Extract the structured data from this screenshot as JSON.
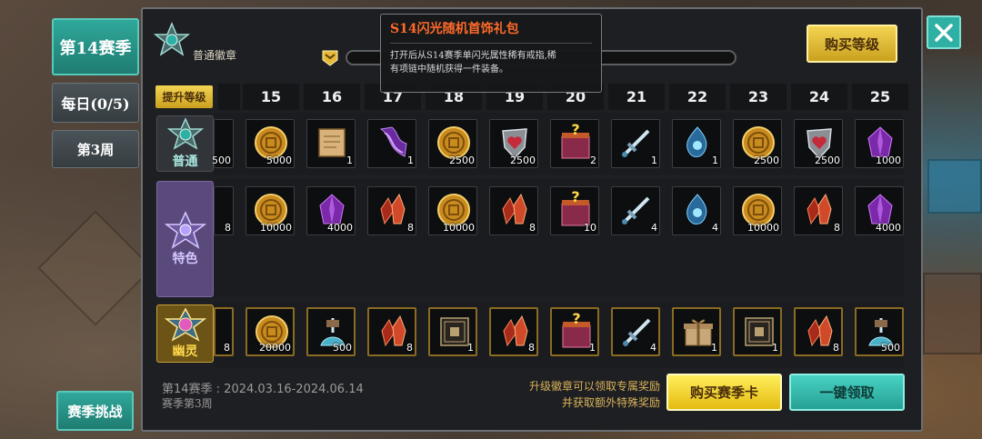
{
  "nav": {
    "season_tab": "第14赛季",
    "daily_tab": "每日(0/5)",
    "week_tab": "第3周",
    "challenge_button": "赛季挑战"
  },
  "header": {
    "badge_name": "普通徽章",
    "xp_progress": 0.0,
    "buy_level_button": "购买等级",
    "raise_level_button": "提升等级"
  },
  "tooltip": {
    "title": "S14闪光随机首饰礼包",
    "description_line1": "打开后从S14赛季单闪光属性稀有戒指,稀",
    "description_line2": "有项链中随机获得一件装备。"
  },
  "levels": [
    "15",
    "16",
    "17",
    "18",
    "19",
    "20",
    "21",
    "22",
    "23",
    "24",
    "25"
  ],
  "tiers": [
    {
      "key": "normal",
      "label": "普通",
      "color": "#a9e5df"
    },
    {
      "key": "rare",
      "label": "特色",
      "color": "#d6c6ff"
    },
    {
      "key": "ghost",
      "label": "幽灵",
      "color": "#ffd84a"
    }
  ],
  "rewards": {
    "normal": {
      "partial_qty": "500",
      "items": [
        {
          "icon": "gold-coin",
          "qty": "5000"
        },
        {
          "icon": "scroll",
          "qty": "1"
        },
        {
          "icon": "purple-cloth",
          "qty": "1"
        },
        {
          "icon": "gold-coin",
          "qty": "2500"
        },
        {
          "icon": "heart-shield",
          "qty": "2500"
        },
        {
          "icon": "mystery-box",
          "qty": "2"
        },
        {
          "icon": "sword",
          "qty": "1"
        },
        {
          "icon": "blue-essence",
          "qty": "1"
        },
        {
          "icon": "gold-coin",
          "qty": "2500"
        },
        {
          "icon": "heart-shield",
          "qty": "2500"
        },
        {
          "icon": "purple-crystal",
          "qty": "1000"
        }
      ]
    },
    "rare": {
      "partial_qty": "8",
      "items": [
        {
          "icon": "gold-coin",
          "qty": "10000"
        },
        {
          "icon": "purple-crystal",
          "qty": "4000"
        },
        {
          "icon": "red-crystal",
          "qty": "8"
        },
        {
          "icon": "gold-coin",
          "qty": "10000"
        },
        {
          "icon": "red-crystal",
          "qty": "8"
        },
        {
          "icon": "mystery-box",
          "qty": "10"
        },
        {
          "icon": "sword",
          "qty": "4"
        },
        {
          "icon": "blue-essence",
          "qty": "4"
        },
        {
          "icon": "gold-coin",
          "qty": "10000"
        },
        {
          "icon": "red-crystal",
          "qty": "8"
        },
        {
          "icon": "purple-crystal",
          "qty": "4000"
        }
      ]
    },
    "ghost": {
      "partial_qty": "8",
      "items": [
        {
          "icon": "gold-coin",
          "qty": "20000"
        },
        {
          "icon": "fountain",
          "qty": "500"
        },
        {
          "icon": "red-crystal",
          "qty": "8"
        },
        {
          "icon": "ticket",
          "qty": "1"
        },
        {
          "icon": "red-crystal",
          "qty": "8"
        },
        {
          "icon": "mystery-box",
          "qty": "1"
        },
        {
          "icon": "sword",
          "qty": "4"
        },
        {
          "icon": "gift-box",
          "qty": "1"
        },
        {
          "icon": "ticket",
          "qty": "1"
        },
        {
          "icon": "red-crystal",
          "qty": "8"
        },
        {
          "icon": "fountain",
          "qty": "500"
        }
      ]
    }
  },
  "footer": {
    "season_dates": "第14赛季 : 2024.03.16-2024.06.14",
    "season_week": "赛季第3周",
    "note_line1": "升级徽章可以领取专属奖励",
    "note_line2": "并获取额外特殊奖励",
    "buy_card_button": "购买赛季卡",
    "claim_all_button": "一键领取"
  },
  "colors": {
    "teal_accent": "#2fa89a",
    "gold_button": "#f3d452",
    "tooltip_title": "#ff6a2a"
  }
}
